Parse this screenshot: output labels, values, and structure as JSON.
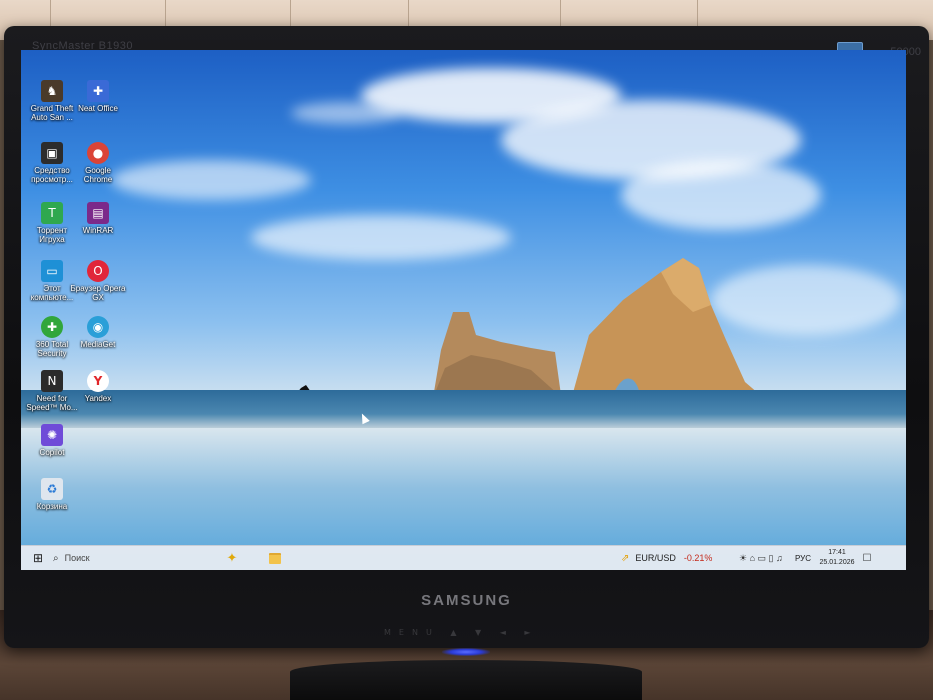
{
  "monitor": {
    "model_label": "SyncMaster B1930",
    "model_right": "50000",
    "brand": "SAMSUNG",
    "buttons": "MENU ▲ ▼ ◄ ►"
  },
  "desktop_icons": [
    {
      "label": "Grand Theft Auto San ...",
      "icon": "gta-icon",
      "color": "#4a3a2a"
    },
    {
      "label": "Neat Office",
      "icon": "neat-office-icon",
      "color": "#3a6ad6"
    },
    {
      "label": "Средство просмотр...",
      "icon": "photo-viewer-icon",
      "color": "#2c2c2c"
    },
    {
      "label": "Google Chrome",
      "icon": "chrome-icon",
      "color": "#db4437"
    },
    {
      "label": "Торрент Игруха",
      "icon": "torrent-icon",
      "color": "#2fa84f"
    },
    {
      "label": "WinRAR",
      "icon": "winrar-icon",
      "color": "#7b2a8a"
    },
    {
      "label": "Этот компьюте...",
      "icon": "this-pc-icon",
      "color": "#1e90d6"
    },
    {
      "label": "Браузер Opera GX",
      "icon": "opera-gx-icon",
      "color": "#e1263a"
    },
    {
      "label": "360 Total Security",
      "icon": "360-security-icon",
      "color": "#31a63b"
    },
    {
      "label": "MediaGet",
      "icon": "mediaget-icon",
      "color": "#2a9fd8"
    },
    {
      "label": "Need for Speed™ Mo...",
      "icon": "nfs-icon",
      "color": "#2b2b2b"
    },
    {
      "label": "Yandex",
      "icon": "yandex-icon",
      "color": "#ffffff"
    },
    {
      "label": "Copilot",
      "icon": "copilot-icon",
      "color": "#6f4bd8"
    },
    {
      "label": "Корзина",
      "icon": "recycle-bin-icon",
      "color": "#dfe6ee"
    }
  ],
  "taskbar": {
    "start_glyph": "⊞",
    "search_glyph": "⌕",
    "search_placeholder": "Поиск",
    "copilot_glyph": "✦",
    "stock_glyph": "⇗",
    "stock_label": "EUR/USD",
    "stock_change": "-0.21%",
    "tray_glyphs": "☀ ⌂ ▭ ▯ ♫",
    "lang": "РУС",
    "time": "17:41",
    "date": "25.01.2026",
    "notif_glyph": "☐"
  }
}
